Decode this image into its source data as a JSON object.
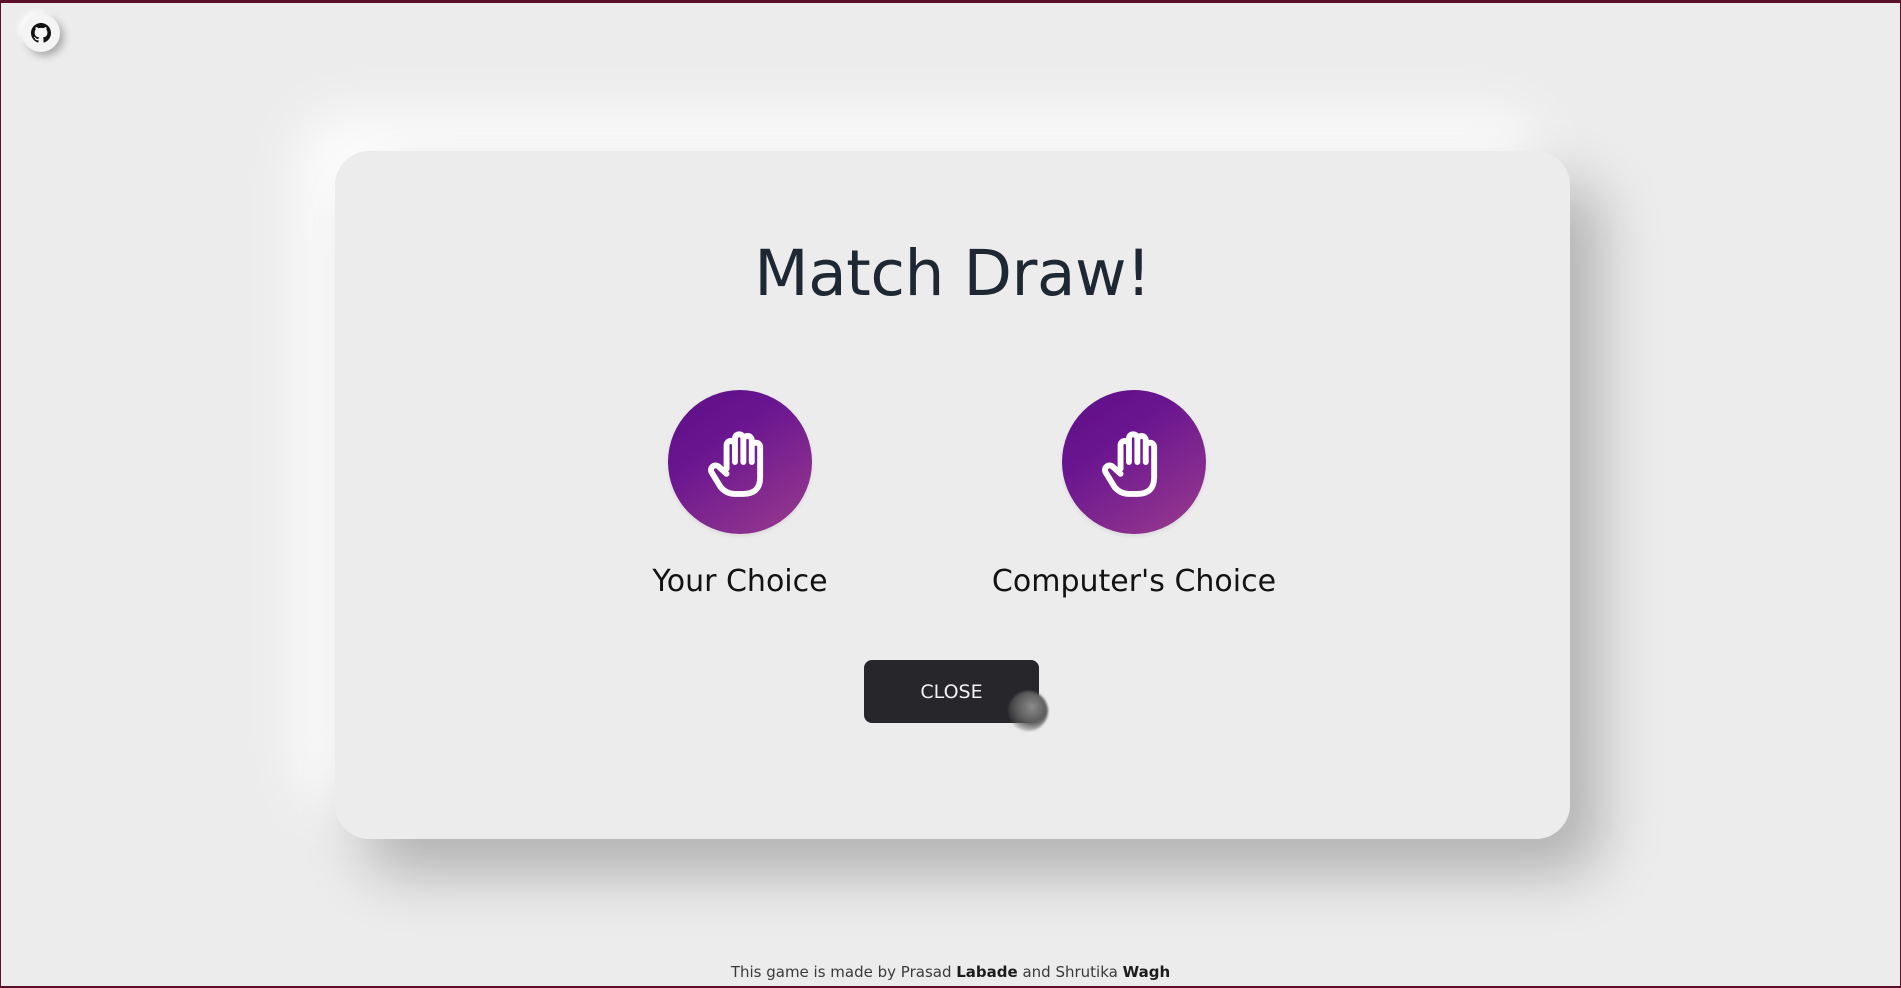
{
  "github": {
    "icon": "github-icon"
  },
  "modal": {
    "title": "Match Draw!",
    "user_choice": {
      "icon": "hand-paper-icon",
      "label": "Your Choice"
    },
    "computer_choice": {
      "icon": "hand-paper-icon",
      "label": "Computer's Choice"
    },
    "close_label": "CLOSE"
  },
  "footer": {
    "prefix": "This game is made by ",
    "author1_first": "Prasad",
    "author1_last": "Labade",
    "joiner": " and ",
    "author2_first": "Shrutika",
    "author2_last": "Wagh"
  },
  "colors": {
    "background": "#ececec",
    "choice_gradient_start": "#5c0f86",
    "choice_gradient_end": "#9a3c8e",
    "button": "#26262b",
    "title": "#1e2833"
  }
}
